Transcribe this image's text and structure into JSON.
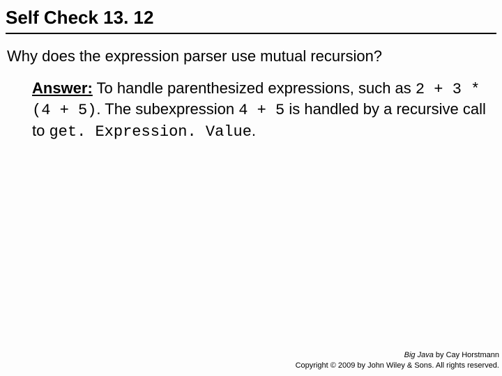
{
  "title": "Self Check 13. 12",
  "question": "Why does the expression parser use mutual recursion?",
  "answer": {
    "label": "Answer:",
    "part1": " To handle parenthesized expressions, such as ",
    "code1": "2 + 3 * (4 + 5)",
    "part2": ". The subexpression ",
    "code2": "4 + 5",
    "part3": " is handled by a recursive call to ",
    "code3": "get. Expression. Value",
    "part4": "."
  },
  "footer": {
    "book": "Big Java",
    "byline": " by Cay Horstmann",
    "copyright": "Copyright © 2009 by John Wiley & Sons. All rights reserved."
  }
}
